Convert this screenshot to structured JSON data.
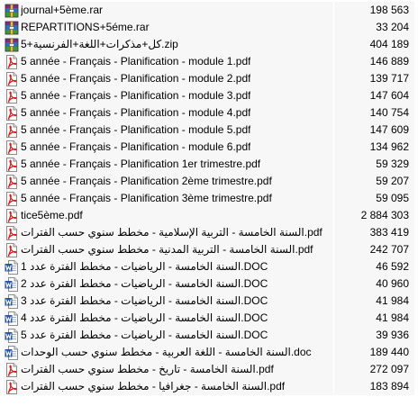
{
  "files": [
    {
      "name": "journal+5ème.rar",
      "size": "198 563",
      "icon": "rar-archive-icon"
    },
    {
      "name": "REPARTITIONS+5éme.rar",
      "size": "33 204",
      "icon": "rar-archive-icon"
    },
    {
      "name": "5+كل+مذكرات+اللغة+الفرنسية.zip",
      "size": "404 189",
      "icon": "rar-archive-icon"
    },
    {
      "name": "5 année - Français - Planification - module 1.pdf",
      "size": "146 889",
      "icon": "pdf-file-icon"
    },
    {
      "name": "5 année - Français - Planification - module 2.pdf",
      "size": "139 717",
      "icon": "pdf-file-icon"
    },
    {
      "name": "5 année - Français - Planification - module 3.pdf",
      "size": "147 604",
      "icon": "pdf-file-icon"
    },
    {
      "name": "5 année - Français - Planification - module 4.pdf",
      "size": "140 754",
      "icon": "pdf-file-icon"
    },
    {
      "name": "5 année - Français - Planification - module 5.pdf",
      "size": "147 609",
      "icon": "pdf-file-icon"
    },
    {
      "name": "5 année - Français - Planification - module 6.pdf",
      "size": "134 962",
      "icon": "pdf-file-icon"
    },
    {
      "name": "5 année - Français - Planification 1er trimestre.pdf",
      "size": "59 329",
      "icon": "pdf-file-icon"
    },
    {
      "name": "5 année - Français - Planification 2ème trimestre.pdf",
      "size": "59 207",
      "icon": "pdf-file-icon"
    },
    {
      "name": "5 année - Français - Planification 3ème trimestre.pdf",
      "size": "59 095",
      "icon": "pdf-file-icon"
    },
    {
      "name": "tice5ème.pdf",
      "size": "2 884 303",
      "icon": "pdf-file-icon"
    },
    {
      "name": "السنة الخامسة - التربية الإسلامية - مخطط سنوي حسب الفترات.pdf",
      "size": "383 419",
      "icon": "pdf-file-icon"
    },
    {
      "name": "السنة الخامسة - التربية المدنية - مخطط سنوي حسب الفترات.pdf",
      "size": "242 707",
      "icon": "pdf-file-icon"
    },
    {
      "name": "السنة الخامسة - الرياضيات - مخطط الفترة عدد 1.DOC",
      "size": "46 592",
      "icon": "word-doc-icon"
    },
    {
      "name": "السنة الخامسة - الرياضيات - مخطط الفترة عدد 2.DOC",
      "size": "40 960",
      "icon": "word-doc-icon"
    },
    {
      "name": "السنة الخامسة - الرياضيات - مخطط الفترة عدد 3.DOC",
      "size": "41 984",
      "icon": "word-doc-icon"
    },
    {
      "name": "السنة الخامسة - الرياضيات - مخطط الفترة عدد 4.DOC",
      "size": "41 984",
      "icon": "word-doc-icon"
    },
    {
      "name": "السنة الخامسة - الرياضيات - مخطط الفترة عدد 5.DOC",
      "size": "39 936",
      "icon": "word-doc-icon"
    },
    {
      "name": "السنة الخامسة - اللغة العربية - مخطط سنوي حسب الوحدات.doc",
      "size": "189 440",
      "icon": "word-doc-icon"
    },
    {
      "name": "السنة الخامسة - تاريخ - مخطط سنوي حسب الفترات.pdf",
      "size": "272 097",
      "icon": "pdf-file-icon"
    },
    {
      "name": "السنة الخامسة - جغرافيا - مخطط سنوي حسب الفترات.pdf",
      "size": "183 894",
      "icon": "pdf-file-icon"
    }
  ],
  "colors": {
    "row_bg": "#f7f7f7",
    "pdf_red": "#d5191b",
    "word_blue": "#2b579a",
    "rar_purple": "#7b2c83"
  }
}
